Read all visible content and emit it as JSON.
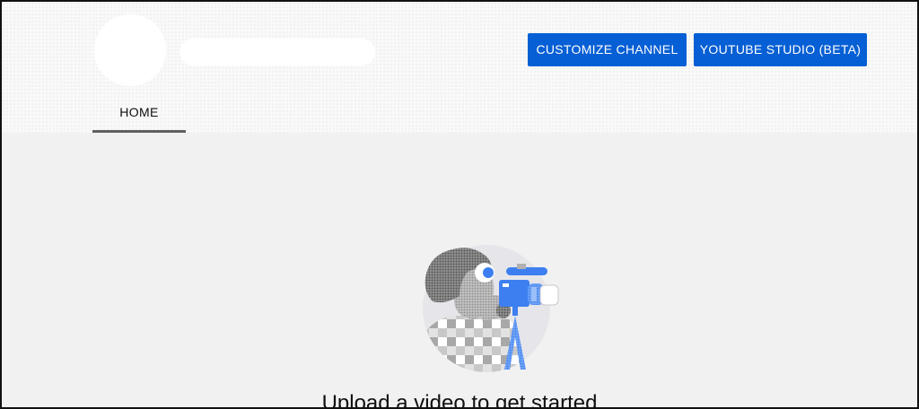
{
  "header": {
    "customize_label": "CUSTOMIZE CHANNEL",
    "studio_label": "YOUTUBE STUDIO (BETA)"
  },
  "tabs": [
    {
      "label": "HOME",
      "selected": true
    }
  ],
  "empty_state": {
    "illustration": "videographer-with-camera-illustration",
    "title": "Upload a video to get started"
  },
  "colors": {
    "primary_button": "#065fd4",
    "header_background": "#f9f9f9",
    "page_background": "#f1f1f1",
    "camera_blue": "#3d7ff0",
    "tab_underline": "#606060"
  }
}
